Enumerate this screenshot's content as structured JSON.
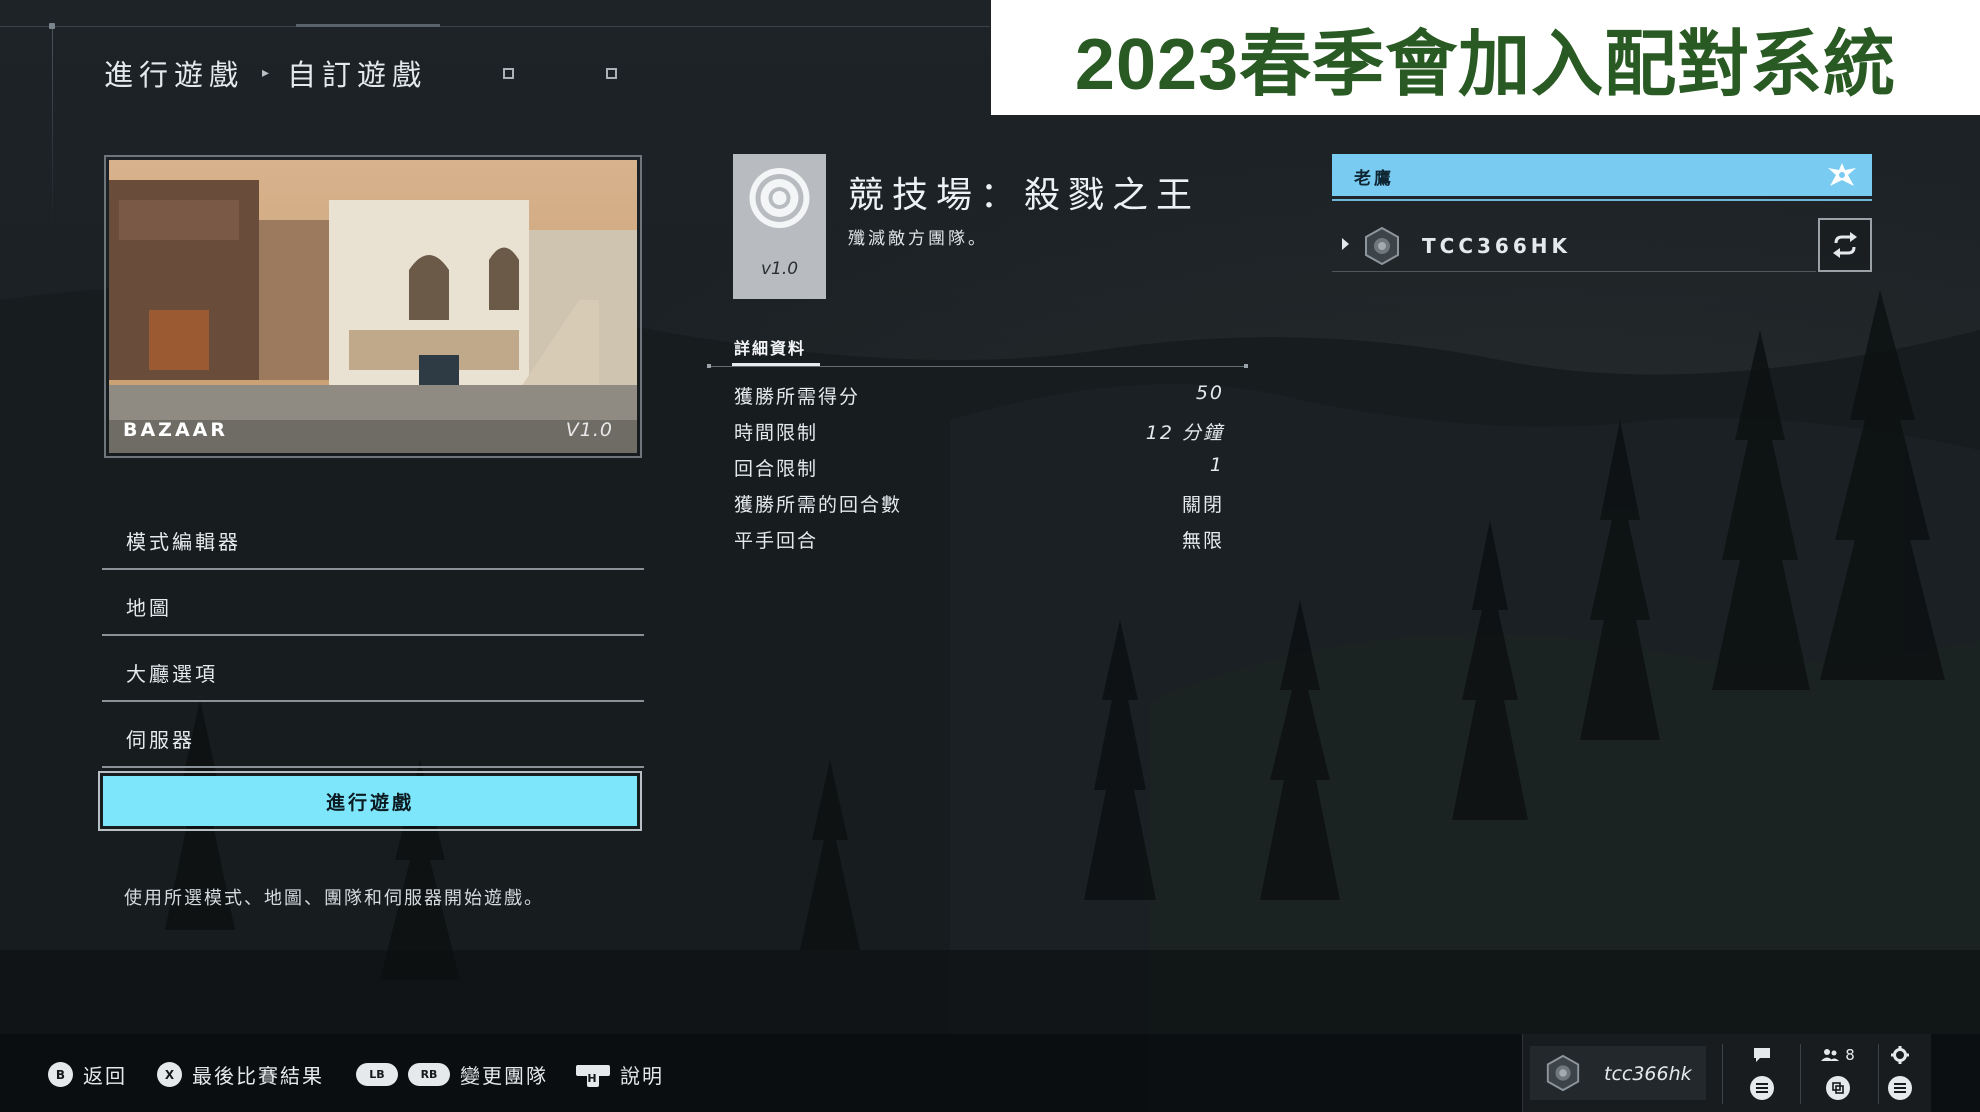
{
  "banner": {
    "text": "2023春季會加入配對系統"
  },
  "breadcrumb": {
    "parent": "進行遊戲",
    "current": "自訂遊戲"
  },
  "map": {
    "name": "BAZAAR",
    "version": "V1.0"
  },
  "menu": {
    "items": [
      {
        "label": "模式編輯器"
      },
      {
        "label": "地圖"
      },
      {
        "label": "大廳選項"
      },
      {
        "label": "伺服器"
      }
    ],
    "play_label": "進行遊戲",
    "description": "使用所選模式、地圖、團隊和伺服器開始遊戲。"
  },
  "mode": {
    "icon": "oddball-target-icon",
    "version": "v1.0",
    "title": "競技場：殺戮之王",
    "subtitle": "殲滅敵方團隊。"
  },
  "details": {
    "tab_label": "詳細資料",
    "rows": [
      {
        "label": "獲勝所需得分",
        "value": "50"
      },
      {
        "label": "時間限制",
        "value": "12 分鐘"
      },
      {
        "label": "回合限制",
        "value": "1"
      },
      {
        "label": "獲勝所需的回合數",
        "value": "關閉"
      },
      {
        "label": "平手回合",
        "value": "無限"
      }
    ]
  },
  "team": {
    "name": "老鷹",
    "emblem": "eagle-emblem-icon",
    "color": "#79cbf2",
    "players": [
      {
        "gamertag": "TCC366HK"
      }
    ]
  },
  "bottom_hints": {
    "back": {
      "button": "B",
      "label": "返回"
    },
    "last_match": {
      "button": "X",
      "label": "最後比賽結果"
    },
    "change_team": {
      "buttons": [
        "LB",
        "RB"
      ],
      "label": "變更團隊"
    },
    "help": {
      "button": "H",
      "label": "說明"
    }
  },
  "system": {
    "gamertag": "tcc366hk",
    "friends_count": "8"
  },
  "colors": {
    "accent_play": "#7de6fb",
    "banner_text": "#2a5a23"
  }
}
